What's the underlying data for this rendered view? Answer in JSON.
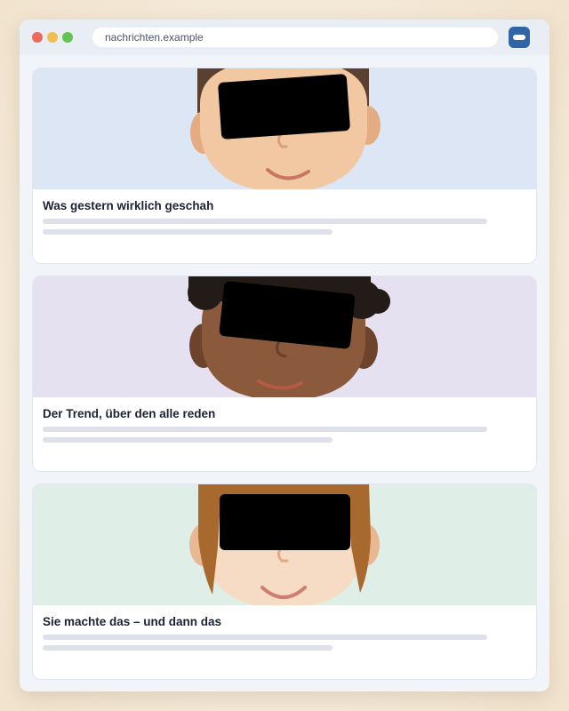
{
  "browser": {
    "url": "nachrichten.example",
    "extension_icon": "toggle-icon"
  },
  "colors": {
    "thumb_bg": [
      "#dce6f4",
      "#e6e1f0",
      "#dfeee7"
    ],
    "skin": [
      "#f2c8a2",
      "#8b5a3c",
      "#f6dcc4"
    ],
    "hair": [
      "#5a4030",
      "#231b17",
      "#a8692e"
    ],
    "censor_bar": "#000000"
  },
  "articles": [
    {
      "title": "Was gestern wirklich geschah"
    },
    {
      "title": "Der Trend, über den alle reden"
    },
    {
      "title": "Sie machte das – und dann das"
    }
  ]
}
